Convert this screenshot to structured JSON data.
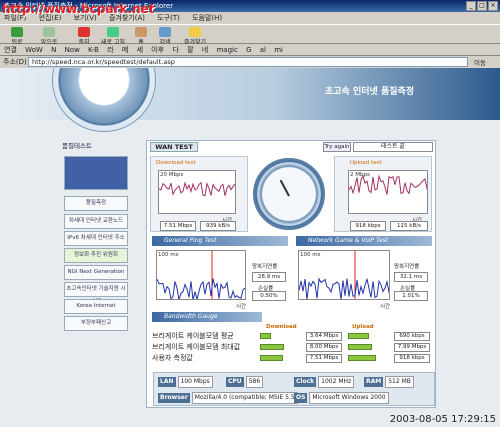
{
  "browser": {
    "title": "초고속 인터넷 품질측정 - Microsoft Internet Explorer",
    "menu": [
      "파일(F)",
      "편집(E)",
      "보기(V)",
      "즐겨찾기(A)",
      "도구(T)",
      "도움말(H)"
    ],
    "toolbar": [
      "뒤로",
      "앞으로",
      "중지",
      "새로 고침",
      "홈",
      "검색",
      "즐겨찾기"
    ],
    "links_label": "연결",
    "links": [
      "WoW",
      "N",
      "Now",
      "K-B",
      "라",
      "메",
      "세",
      "아후",
      "다",
      "팔",
      "네",
      "magic",
      "G",
      "al",
      "mi"
    ],
    "address_label": "주소(D)",
    "url": "http://speed.nca.or.kr/speedtest/default.asp",
    "go_label": "이동",
    "watermark": "http://www.bcpark.net",
    "datestamp": "2003-08-05 17:29:15"
  },
  "banner": {
    "title": "초고속 인터넷 품질측정",
    "dial_words": [
      "요인",
      "유속",
      "유형분석"
    ]
  },
  "sidebar": {
    "heading": "품질테스트",
    "items": [
      "품질측정",
      "차세대 인터넷 교환노드",
      "IPv6 차세대 인터넷 주소",
      "정보화 추진 위원회",
      "NGI Next Generation",
      "초고속인터넷 기술지원 시스템",
      "Korea Internet Exchange",
      "부정부패신고"
    ]
  },
  "wan": {
    "tab": "WAN TEST",
    "try_again": "Try again",
    "end_label": "테스트 끝",
    "download": {
      "title": "Download test",
      "ymax": "20 Mbps",
      "xlabel": "시간",
      "mbps": "7.51 Mbps",
      "kbs": "939 kB/s"
    },
    "upload": {
      "title": "Upload test",
      "ymax": "2 Mbps",
      "xlabel": "시간",
      "kbps": "918 kbps",
      "kbs": "115 kB/s"
    },
    "ping": {
      "title": "General Ping Test",
      "ymax": "100 ms",
      "xlabel": "시간",
      "latency_label": "왕복지연률",
      "latency": "28.9 ms",
      "loss_label": "손실률",
      "loss": "0.50%"
    },
    "game": {
      "title": "Network Game & VoIP Test",
      "ymax": "100 ms",
      "xlabel": "시간",
      "latency_label": "왕복지연률",
      "latency": "32.1 ms",
      "loss_label": "손실률",
      "loss": "1.01%"
    },
    "bandwidth_title": "Bandwidth Gauge"
  },
  "table": {
    "download_header": "Download",
    "upload_header": "Upload",
    "rows": [
      {
        "label": "브리게이트 케이블모뎀 평균",
        "down": "3.64 Mbps",
        "up": "690 kbps",
        "down_frac": 0.36,
        "up_frac": 0.69
      },
      {
        "label": "브리게이트 케이블모뎀 최대값",
        "down": "8.00 Mbps",
        "up": "7.99 Mbps",
        "down_frac": 0.8,
        "up_frac": 0.8
      },
      {
        "label": "사용자 측정값",
        "down": "7.51 Mbps",
        "up": "918 kbps",
        "down_frac": 0.75,
        "up_frac": 0.92
      }
    ]
  },
  "system": {
    "lan_label": "LAN",
    "lan": "100 Mbps",
    "cpu_label": "CPU",
    "cpu": "586",
    "clock_label": "Clock",
    "clock": "1002 MHz",
    "ram_label": "RAM",
    "ram": "512 MB",
    "browser_label": "Browser",
    "browser": "Mozilla/4.0 (compatible; MSIE 5.5",
    "os_label": "OS",
    "os": "Microsoft Windows 2000"
  },
  "colors": {
    "download": "#a3305f",
    "upload": "#a3305f",
    "ping": "#2233aa",
    "accent_red": "#e61e1e",
    "green": "#8cc63e",
    "blue_header": "#3b69a3"
  }
}
